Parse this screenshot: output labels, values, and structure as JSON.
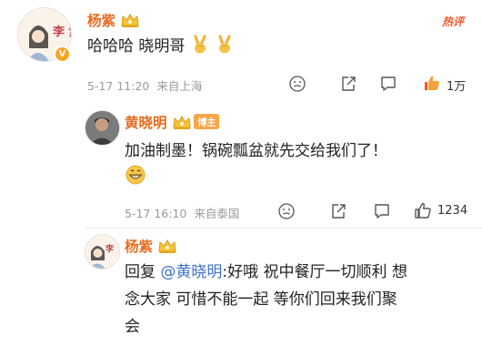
{
  "hot_badge": "热评",
  "main_comment": {
    "username": "杨紫",
    "text": "哈哈哈 晓明哥",
    "time": "5-17 11:20",
    "location": "来自上海",
    "likes": "1万",
    "verified_mark": "V",
    "avatar_text": "李 紫"
  },
  "reply1": {
    "username": "黄晓明",
    "tag": "博主",
    "text": "加油制墨！锅碗瓢盆就先交给我们了！",
    "time": "5-17 16:10",
    "location": "来自泰国",
    "likes": "1234"
  },
  "reply2": {
    "username": "杨紫",
    "prefix": "回复 ",
    "mention": "@黄晓明",
    "line1_rest": ":好哦 祝中餐厅一切顺利 想",
    "line2": "念大家 可惜不能一起 等你们回来我们聚",
    "line3": "会",
    "avatar_text": "李"
  },
  "colors": {
    "name": "#e76c1f",
    "meta": "#9a9a9a",
    "like_active": "#f2672a",
    "mention": "#3f72c6",
    "hot": "#f2572d"
  }
}
